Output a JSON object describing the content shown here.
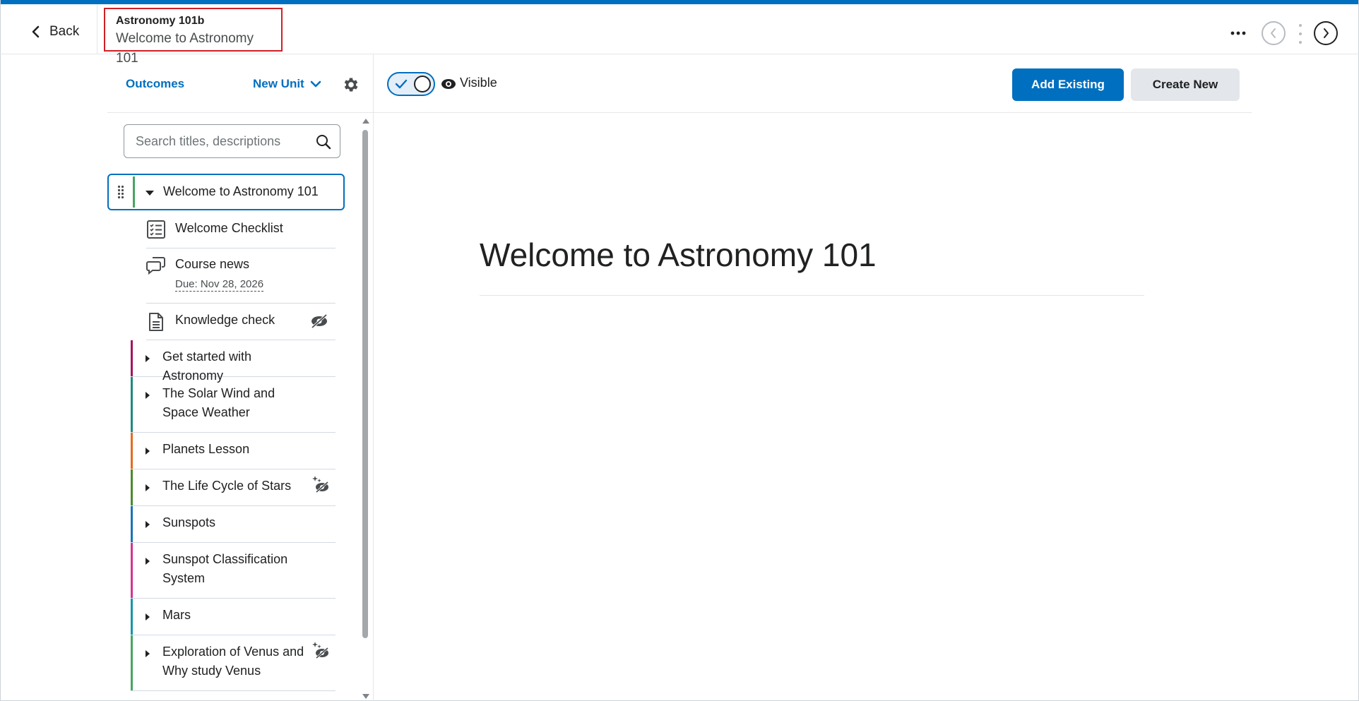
{
  "header": {
    "back_label": "Back",
    "course_name": "Astronomy 101b",
    "breadcrumb_title": "Welcome to Astronomy 101"
  },
  "sidebar": {
    "outcomes_label": "Outcomes",
    "new_unit_label": "New Unit",
    "search_placeholder": "Search titles, descriptions",
    "selected_unit": {
      "label": "Welcome to Astronomy 101",
      "color": "#46a661"
    },
    "children": [
      {
        "label": "Welcome Checklist",
        "icon": "checklist-icon"
      },
      {
        "label": "Course news",
        "due": "Due: Nov 28, 2026",
        "icon": "discussion-icon"
      },
      {
        "label": "Knowledge check",
        "icon": "document-icon",
        "hidden": true
      }
    ],
    "units": [
      {
        "label": "Get started with Astronomy",
        "color": "#a3155e"
      },
      {
        "label": "The Solar Wind and Space Weather",
        "color": "#1e8a7e"
      },
      {
        "label": "Planets Lesson",
        "color": "#e56b1f"
      },
      {
        "label": "The Life Cycle of Stars",
        "color": "#4a8b2c",
        "scheduled": true
      },
      {
        "label": "Sunspots",
        "color": "#1a73b8"
      },
      {
        "label": "Sunspot Classification System",
        "color": "#d6338f"
      },
      {
        "label": "Mars",
        "color": "#1597a9"
      },
      {
        "label": "Exploration of Venus and Why study Venus",
        "color": "#46a661",
        "scheduled": true
      }
    ]
  },
  "toolbar": {
    "visibility_label": "Visible",
    "add_existing_label": "Add Existing",
    "create_new_label": "Create New"
  },
  "content": {
    "title": "Welcome to Astronomy 101"
  },
  "colors": {
    "accent": "#006fbf",
    "breadcrumb_outline": "#cd2026"
  }
}
